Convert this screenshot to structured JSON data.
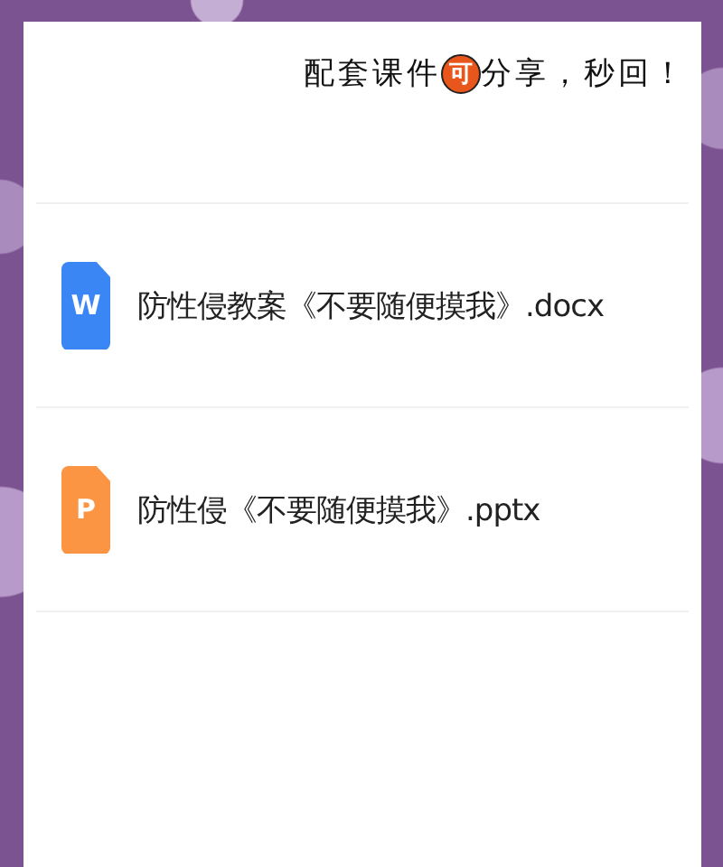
{
  "banner": {
    "before": "配套课件",
    "highlight": "可",
    "after": "分享，秒回！"
  },
  "files": [
    {
      "kind": "docx",
      "icon_letter": "W",
      "name": "防性侵教案《不要随便摸我》.docx"
    },
    {
      "kind": "pptx",
      "icon_letter": "P",
      "name": "防性侵《不要随便摸我》.pptx"
    }
  ]
}
